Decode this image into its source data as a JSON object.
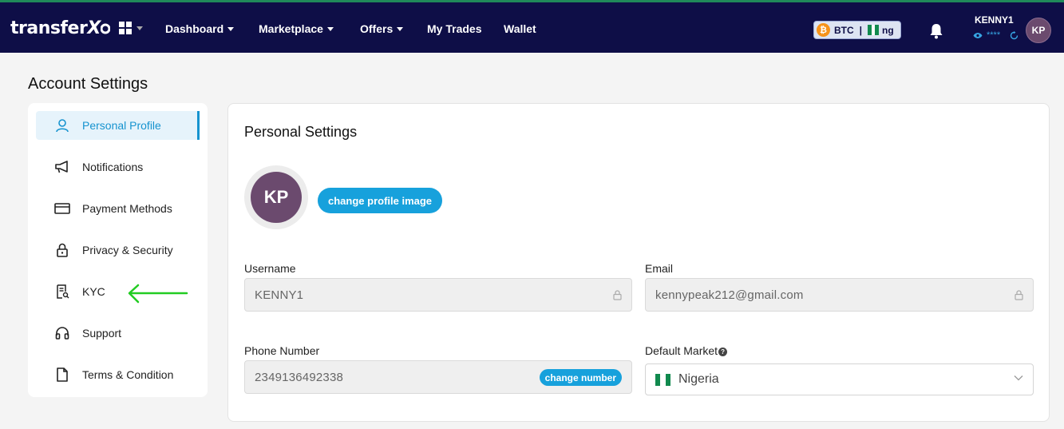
{
  "brand": {
    "logo_text": "transfer",
    "logo_suffix": "X"
  },
  "nav": {
    "items": [
      {
        "label": "Dashboard",
        "has_caret": true
      },
      {
        "label": "Marketplace",
        "has_caret": true
      },
      {
        "label": "Offers",
        "has_caret": true
      },
      {
        "label": "My Trades",
        "has_caret": false
      },
      {
        "label": "Wallet",
        "has_caret": false
      }
    ],
    "currency_pill": {
      "coin": "BTC",
      "separator": "|",
      "market": "ng"
    },
    "user": {
      "username": "KENNY1",
      "balance_masked": "****",
      "initials": "KP"
    }
  },
  "page": {
    "title": "Account Settings"
  },
  "sidebar": {
    "items": [
      {
        "label": "Personal Profile",
        "icon": "user-icon",
        "active": true
      },
      {
        "label": "Notifications",
        "icon": "megaphone-icon",
        "active": false
      },
      {
        "label": "Payment Methods",
        "icon": "card-icon",
        "active": false
      },
      {
        "label": "Privacy & Security",
        "icon": "lock-icon",
        "active": false
      },
      {
        "label": "KYC",
        "icon": "document-icon",
        "active": false
      },
      {
        "label": "Support",
        "icon": "headset-icon",
        "active": false
      },
      {
        "label": "Terms & Condition",
        "icon": "file-icon",
        "active": false
      }
    ]
  },
  "settings": {
    "title": "Personal Settings",
    "avatar_initials": "KP",
    "change_image_label": "change profile image",
    "username": {
      "label": "Username",
      "value": "KENNY1"
    },
    "email": {
      "label": "Email",
      "value": "kennypeak212@gmail.com"
    },
    "phone": {
      "label": "Phone Number",
      "value": "2349136492338",
      "action": "change number"
    },
    "market": {
      "label": "Default Market",
      "help": "?",
      "value": "Nigeria"
    }
  },
  "colors": {
    "navbar": "#0e0e47",
    "accent": "#17a1dc",
    "active_bg": "#e6f3fb",
    "avatar": "#6b4a6e",
    "annotation_arrow": "#22cc22"
  }
}
